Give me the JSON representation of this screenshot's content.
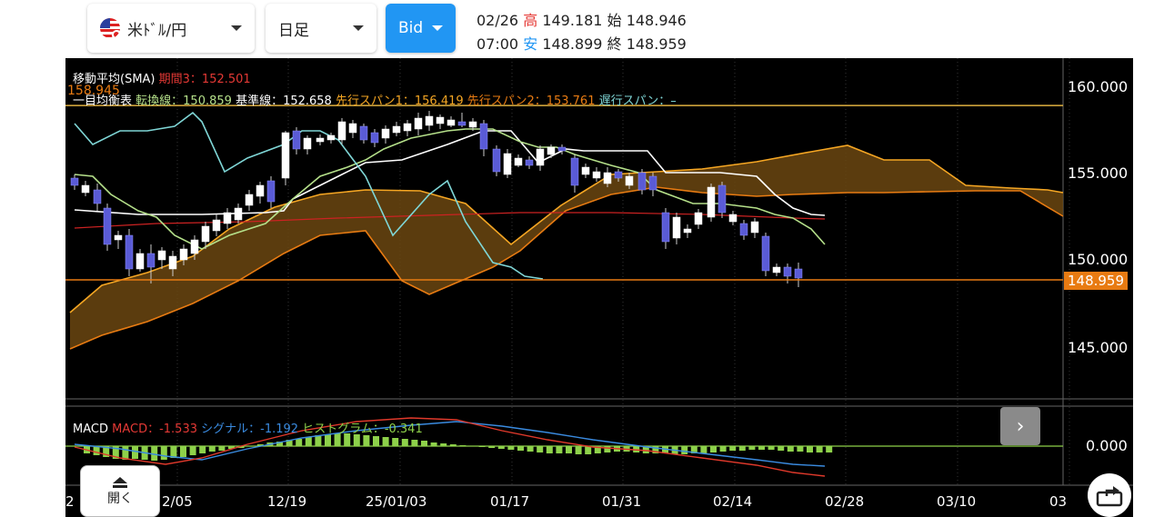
{
  "toolbar": {
    "pair_label": "米ﾄﾞﾙ/円",
    "timeframe_label": "日足",
    "price_type_label": "Bid"
  },
  "ohlc": {
    "date": "02/26",
    "time": "07:00",
    "high_label": "高",
    "high": "149.181",
    "low_label": "安",
    "low": "148.899",
    "open_label": "始",
    "open": "148.946",
    "close_label": "終",
    "close": "148.959"
  },
  "legend": {
    "sma_title": "移動平均(SMA)",
    "sma_period3": "期間3：152.501",
    "ichimoku_title": "一目均衡表",
    "tenkan": "転換線：150.859",
    "kijun": "基準線：152.658",
    "senkou1": "先行スパン1：156.419",
    "senkou2": "先行スパン2：153.761",
    "chikou": "遅行スパン：–",
    "cursor_value": "158.945"
  },
  "price_axis": {
    "ticks": [
      "160.000",
      "155.000",
      "150.000",
      "145.000"
    ],
    "current_price": "148.959",
    "macd_tick": "0.000"
  },
  "macd": {
    "title": "MACD",
    "macd": "MACD：-1.533",
    "signal": "シグナル：-1.192",
    "histogram": "ヒストグラム：-0.341"
  },
  "date_axis": {
    "labels": [
      "2",
      "2/05",
      "12/19",
      "25/01/03",
      "01/17",
      "01/31",
      "02/14",
      "02/28",
      "03/10",
      "03"
    ]
  },
  "controls": {
    "open_label": "開く"
  },
  "colors": {
    "up_candle": "#ffffff",
    "down_candle": "#5a5bd6",
    "tenkan": "#b5e08a",
    "kijun": "#ffffff",
    "senkou1": "#f5a623",
    "senkou2": "#e87b12",
    "chikou": "#7fd6d6",
    "sma": "#cc2222",
    "macd_line": "#e0392b",
    "signal_line": "#3a8be0",
    "histogram": "#8ed14a",
    "current_price": "#e87b12"
  }
}
